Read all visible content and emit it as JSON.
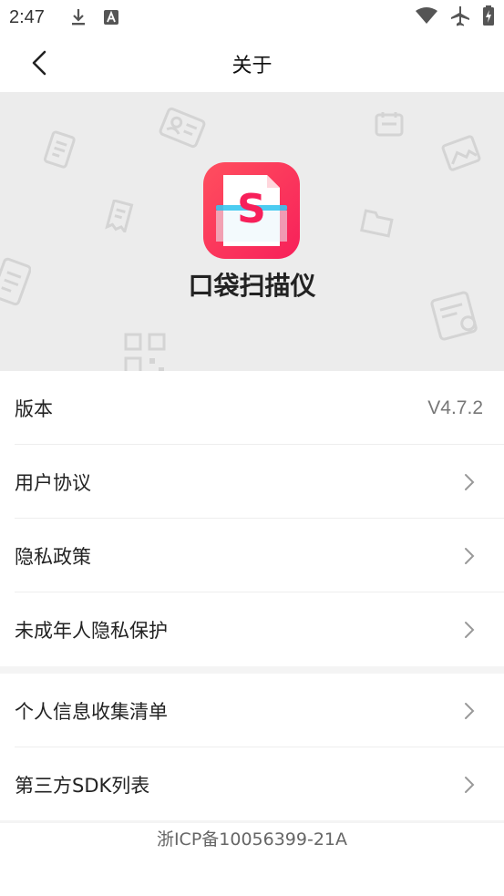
{
  "status_bar": {
    "time": "2:47",
    "icons": [
      "download-icon",
      "a-notification-icon",
      "wifi-icon",
      "airplane-icon",
      "battery-charging-icon"
    ]
  },
  "nav": {
    "title": "关于",
    "back_icon": "chevron-left-icon"
  },
  "hero": {
    "app_name": "口袋扫描仪",
    "app_icon_letter": "S",
    "colors": {
      "icon_gradient_start": "#ff4f5e",
      "icon_gradient_end": "#f7205a",
      "accent_cyan": "#38c7f0",
      "background": "#ececec"
    }
  },
  "settings": {
    "group1": [
      {
        "label": "版本",
        "value": "V4.7.2"
      },
      {
        "label": "用户协议"
      },
      {
        "label": "隐私政策"
      },
      {
        "label": "未成年人隐私保护"
      }
    ],
    "group2": [
      {
        "label": "个人信息收集清单"
      },
      {
        "label": "第三方SDK列表"
      }
    ]
  },
  "footer": {
    "icp": "浙ICP备10056399-21A"
  }
}
